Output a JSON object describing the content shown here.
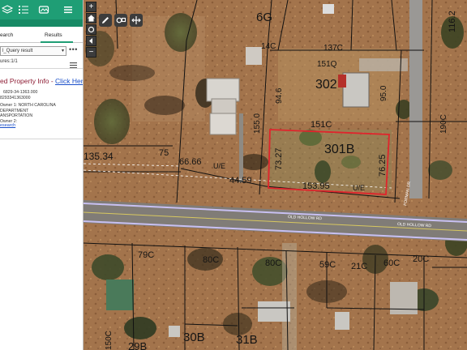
{
  "panel": {
    "tabs": {
      "search": "earch",
      "results": "Results"
    },
    "query_select_value": "l_Query result",
    "more_glyph": "•••",
    "features_count": "ures:1/1",
    "property_title": "ed Property Info - ",
    "property_link": "Click Here",
    "pid_line_1": "6829-34-1363.000",
    "pid_line_2": "8293341363000",
    "owner_line_1": "Owner 1:  NORTH CAROLINA DEPARTMENT",
    "owner_line_2": "ANSPORTATION",
    "owner_line_3": "Owner 2:",
    "search_link": "esearch",
    "icons": [
      "layers-icon",
      "legend-list-icon",
      "basemap-gallery-icon",
      "menu-icon"
    ]
  },
  "map": {
    "toolbar": [
      "zoom-in",
      "home",
      "locate",
      "zoom-out"
    ],
    "top_tools": [
      "pencil-icon",
      "draw-tools-icon",
      "measure-icon"
    ],
    "highlight_color": "#e0242c",
    "parcel_labels": {
      "lot_6G": "6G",
      "lot_14C": "14C",
      "lot_137C": "137C",
      "lot_151Q": "151Q",
      "lot_302": "302",
      "lot_116_2": "116.2",
      "lot_151C": "151C",
      "lot_301B": "301B",
      "lot_190C": "190C",
      "lot_135_34": "135.34",
      "lot_79C": "79C",
      "lot_80C_left": "80C",
      "lot_80C_right": "80C",
      "lot_59C": "59C",
      "lot_21C": "21C",
      "lot_60C": "60C",
      "lot_20C": "20C",
      "lot_30B": "30B",
      "lot_31B": "31B",
      "lot_29B": "29B",
      "lot_150C": "150C"
    },
    "dimensions": {
      "dim_94_6": "94.6",
      "dim_95_0": "95.0",
      "dim_155_0": "155.0",
      "dim_73_27": "73.27",
      "dim_76_25": "76.25",
      "dim_153_95": "153.95",
      "dim_66_66": "66.66",
      "dim_44_59": "44.59",
      "dim_75": "75"
    },
    "easements": {
      "ue_1": "U/E",
      "ue_2": "U/E"
    },
    "road_labels": {
      "old_hollow_rd_1": "OLD HOLLOW RD",
      "old_hollow_rd_2": "OLD HOLLOW RD",
      "forman_dr": "FORMAN DR"
    }
  }
}
